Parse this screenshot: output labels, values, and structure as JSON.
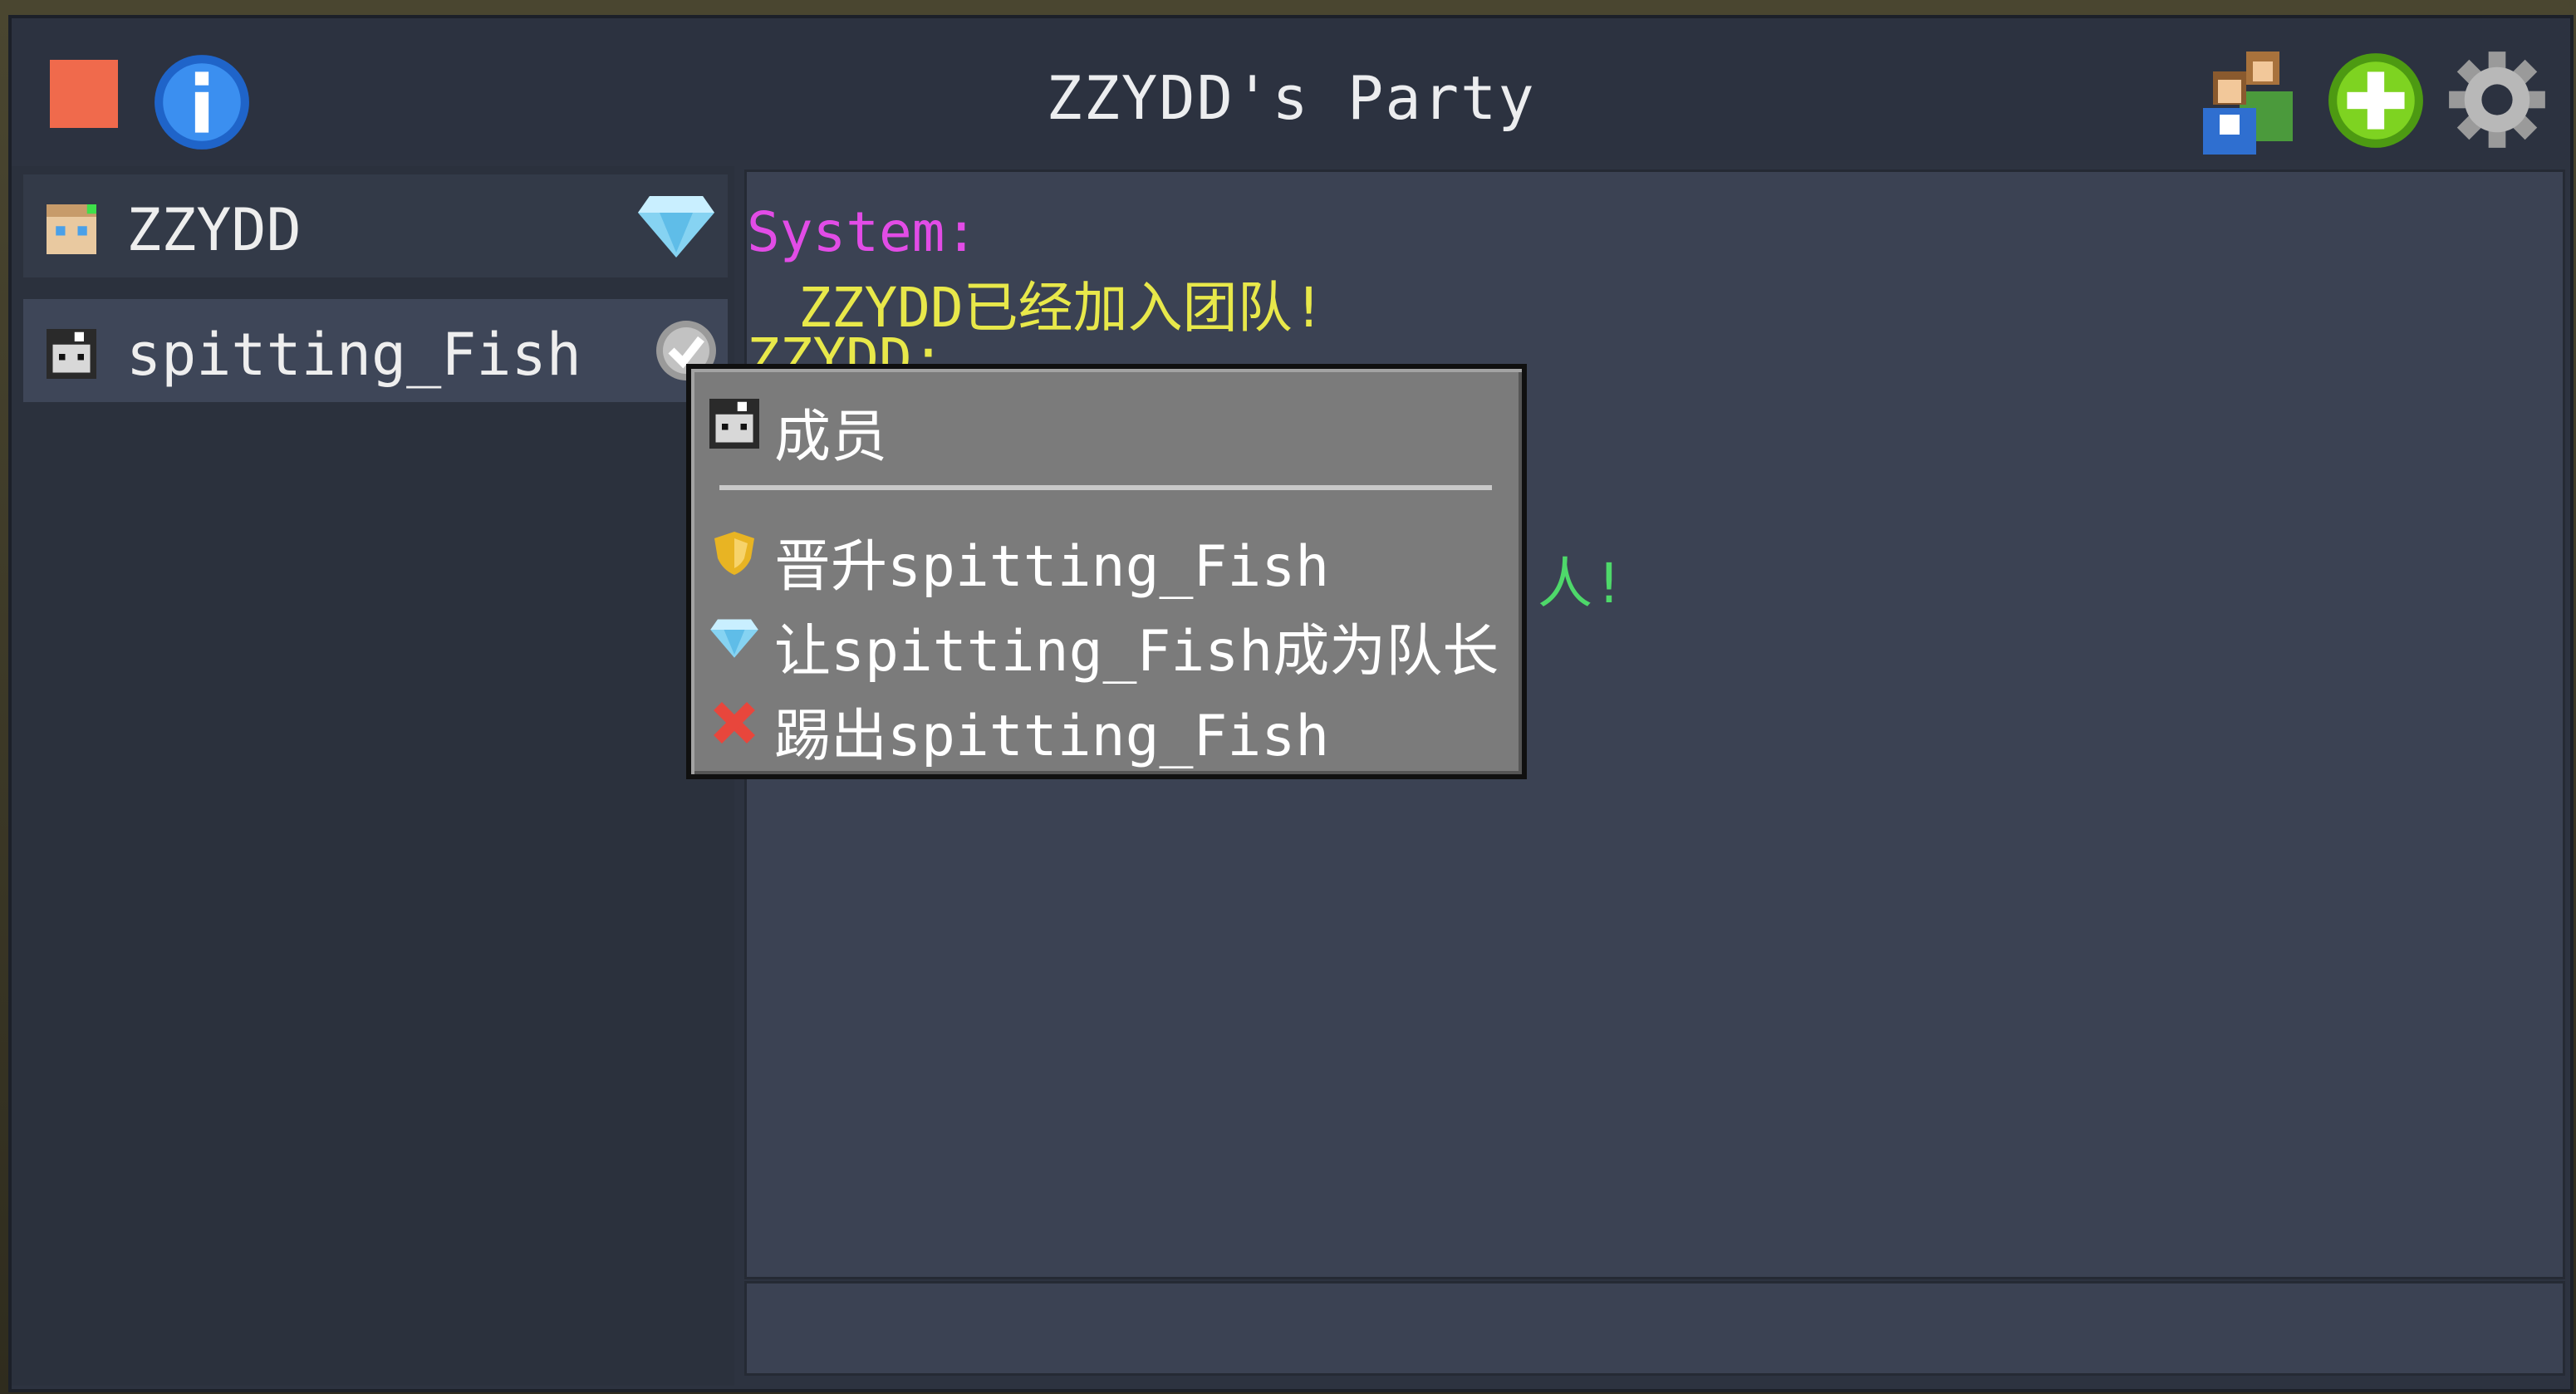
{
  "window": {
    "title": "ZZYDD's Party"
  },
  "toolbar": {
    "close_icon": "close-square-icon",
    "info_icon": "info-icon",
    "party_icon": "party-members-icon",
    "add_icon": "add-icon",
    "settings_icon": "gear-icon"
  },
  "members": [
    {
      "name": "ZZYDD",
      "role_icon": "diamond-icon",
      "role": "leader"
    },
    {
      "name": "spitting_Fish",
      "role_icon": "check-icon",
      "role": "member"
    }
  ],
  "chat": {
    "lines": [
      {
        "text": "System:",
        "color": "#e24ce6"
      },
      {
        "text": "ZZYDD已经加入团队!",
        "color": "#e8e84a"
      },
      {
        "text": "ZZYDD:",
        "color": "#e8e84a"
      },
      {
        "text": "人!",
        "color": "#4ed86a"
      }
    ]
  },
  "context_menu": {
    "header": "成员",
    "items": [
      {
        "label": "晋升spitting_Fish",
        "icon": "shield-icon"
      },
      {
        "label": "让spitting_Fish成为队长",
        "icon": "diamond-icon"
      },
      {
        "label": "踢出spitting_Fish",
        "icon": "x-icon"
      }
    ]
  },
  "colors": {
    "close": "#f06a4c",
    "system": "#e24ce6",
    "yellow": "#e8e84a",
    "green": "#4ed86a"
  }
}
